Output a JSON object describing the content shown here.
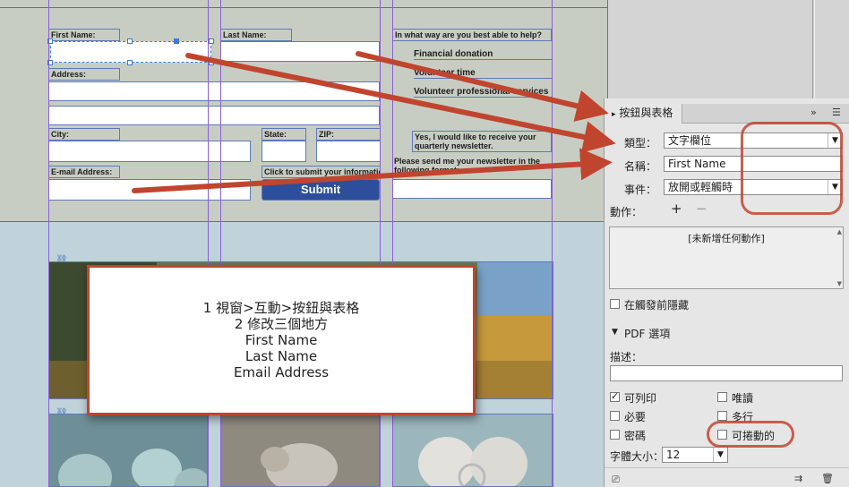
{
  "form": {
    "first_name_label": "First Name:",
    "last_name_label": "Last Name:",
    "address_label": "Address:",
    "city_label": "City:",
    "state_label": "State:",
    "zip_label": "ZIP:",
    "email_label": "E-mail Address:",
    "submit_hint": "Click to submit your information",
    "submit_label": "Submit",
    "help_question": "In what way are you best able to help?",
    "help_options": [
      "Financial donation",
      "Volunteer time",
      "Volunteer professional services"
    ],
    "newsletter_opt": "Yes, I would like to receive your quarterly newsletter.",
    "format_label": "Please send me your newsletter in the following format:"
  },
  "callout": {
    "lines": [
      "1 視窗>互動>按鈕與表格",
      "2 修改三個地方",
      "First Name",
      "Last Name",
      "Email Address"
    ]
  },
  "panel": {
    "title": "按鈕與表格",
    "menu_icon": "panel-menu-icon",
    "type_label": "類型：",
    "type_value": "文字欄位",
    "name_label": "名稱：",
    "name_value": "First Name",
    "event_label": "事件：",
    "event_value": "放開或輕觸時",
    "action_label": "動作：",
    "action_empty": "[未新增任何動作]",
    "hide_until_triggered": "在觸發前隱藏",
    "pdf_section": "PDF 選項",
    "desc_label": "描述：",
    "printable": "可列印",
    "readonly": "唯讀",
    "required": "必要",
    "multiline": "多行",
    "password": "密碼",
    "scrollable": "可捲動的",
    "font_size_label": "字體大小：",
    "font_size_value": "12",
    "printable_checked": true
  },
  "colors": {
    "arrow": "#c0452f",
    "selection": "#3a7bd5",
    "guide": "#8b5ed8",
    "submit": "#2d4e9a"
  }
}
